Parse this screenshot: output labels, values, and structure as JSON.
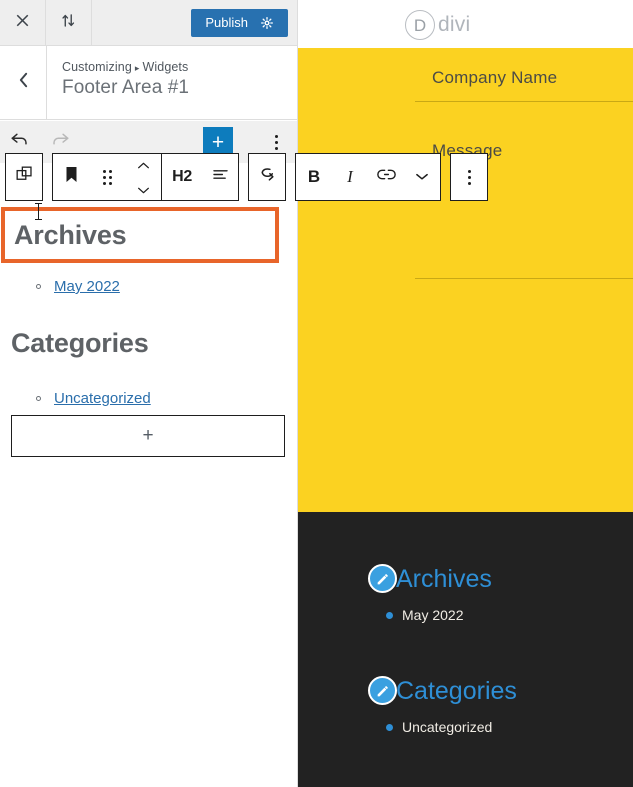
{
  "customizer": {
    "close_label": "Close",
    "close_icon": "close-icon",
    "device_icon": "switch-devices-icon",
    "publish_label": "Publish",
    "publish_settings_icon": "gear-icon",
    "back_icon": "chevron-left-icon",
    "breadcrumb_root": "Customizing",
    "breadcrumb_sep": "▸",
    "breadcrumb_section": "Widgets",
    "panel_title": "Footer Area #1",
    "accent_publish": "#2871b0",
    "accent_add_block": "#0d7cbd",
    "accent_selection": "#e8652a"
  },
  "history_bar": {
    "undo_icon": "undo-arrow-icon",
    "redo_icon": "redo-arrow-icon",
    "add_block_label": "+",
    "add_block_icon": "plus-icon",
    "options_icon": "kebab-menu-icon"
  },
  "block_toolbar": {
    "copy_blocks_icon": "copy-blocks-icon",
    "block_type_icon": "heading-bookmark-icon",
    "drag_handle_icon": "drag-grip-icon",
    "move_up_icon": "chevron-up-icon",
    "move_down_icon": "chevron-down-icon",
    "heading_level_label": "H2",
    "align_icon": "align-text-icon",
    "more_icon": "curved-arrow-icon",
    "bold_label": "B",
    "italic_label": "I",
    "link_icon": "link-icon",
    "more_rich_text_icon": "chevron-down-icon",
    "options_icon": "kebab-menu-icon"
  },
  "editor": {
    "selected_heading": "Archives",
    "archives_items": [
      {
        "label": "May 2022"
      }
    ],
    "categories_heading": "Categories",
    "categories_items": [
      {
        "label": "Uncategorized"
      }
    ],
    "appender_label": "+",
    "appender_icon": "plus-icon"
  },
  "preview": {
    "site_logo_mark": "D",
    "site_logo_word": "divi",
    "form": {
      "company_label": "Company Name",
      "message_label": "Message"
    },
    "footer": {
      "widgets": [
        {
          "title": "Archives",
          "edit_icon": "pencil-edit-icon",
          "items": [
            {
              "label": "May 2022"
            }
          ]
        },
        {
          "title": "Categories",
          "edit_icon": "pencil-edit-icon",
          "items": [
            {
              "label": "Uncategorized"
            }
          ]
        }
      ]
    },
    "colors": {
      "band_yellow": "#fbd221",
      "footer_dark": "#222222",
      "link_blue": "#2e8fd6"
    }
  }
}
